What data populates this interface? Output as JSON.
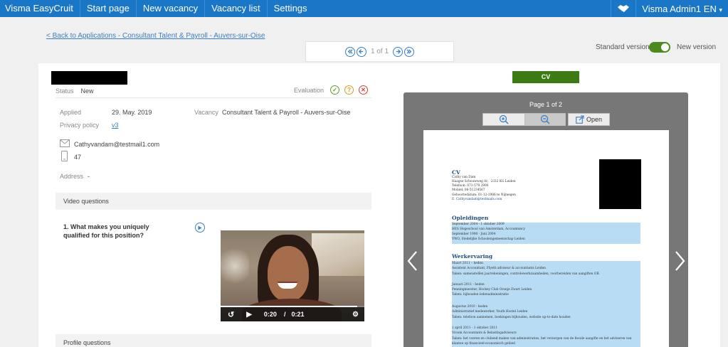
{
  "nav": {
    "brand": "Visma EasyCruit",
    "items": [
      "Start page",
      "New vacancy",
      "Vacancy list",
      "Settings"
    ],
    "user": "Visma Admin1",
    "lang": "EN"
  },
  "back_link": "< Back to Applications - Consultant Talent & Payroll - Auvers-sur-Oise",
  "pager": {
    "text": "1 of 1"
  },
  "version": {
    "standard": "Standard version",
    "new": "New version",
    "new_enabled": true
  },
  "candidate": {
    "status_label": "Status",
    "status_value": "New",
    "evaluation_label": "Evaluation",
    "applied_label": "Applied",
    "applied_value": "29. May. 2019",
    "vacancy_label": "Vacancy",
    "vacancy_value": "Consultant Talent & Payroll - Auvers-sur-Oise",
    "privacy_label": "Privacy policy",
    "privacy_value": "v3",
    "email": "Cathyvandam@testmail1.com",
    "phone": "47",
    "address_label": "Address",
    "address_value": "-"
  },
  "video_section": {
    "title": "Video questions",
    "question": "1. What makes you uniquely qualified for this position?",
    "current_time": "0:20",
    "duration": "0:21",
    "time_separator": "/",
    "progress": 0.95
  },
  "profile_section": {
    "title": "Profile questions"
  },
  "cv": {
    "button": "CV",
    "page_info": "Page 1 of 2",
    "open_label": "Open",
    "doc": {
      "title": "CV",
      "contact": [
        "Cathy van Dam",
        "Haagse Schouwweg 8c,  2332 KG Leiden",
        "Telefoon: 071-579 2990",
        "Mobiel: 06-51234567",
        "Geboortedatum: 01-12-1986 te Nijmegen",
        "E. Cathyvandam@testmails.com"
      ],
      "education_title": "Opleidingen",
      "education": [
        "September 2004 - 1 oktober 2009",
        "HES Hogeschool van Amsterdam, Accountancy",
        "September 1998 - Juni 2004",
        "VWO, Stedelijke Schoolengemeenschap Leiden"
      ],
      "work_title": "Werkervaring",
      "work": [
        "Maart 2011 – heden",
        "Assistent Accountant, Flyeth adviseur & accountants Leiden",
        "Taken: samenstellen jaarrekeningen, controlewerkzaamheden, voorbereiden van aangiften OB.",
        "",
        "Januari 2011 - heden",
        "Penningmeester, Hockey Club Oranje Zwart Leiden",
        "Taken: bijhouden ledenadministratie",
        "",
        "Augustus 2010 - heden",
        "Administratief medewerker, Youth Hostel Leiden",
        "Taken: telefoon aannemen, boekingen bijhouden, website up-to-date houden",
        "",
        "1 april 2011 - 1 oktober 2011",
        "Vroom Accountants & Belastingadviseurs",
        "Taken: het voeren en clubend maken van administraties, het verzorgen van de fiscale aangifte en het adviseren van",
        "klanten op financieel-economisch gebied"
      ]
    }
  },
  "colors": {
    "topbar": "#1a76c6",
    "accent_green": "#3c7a12",
    "link": "#3a7fc4"
  }
}
